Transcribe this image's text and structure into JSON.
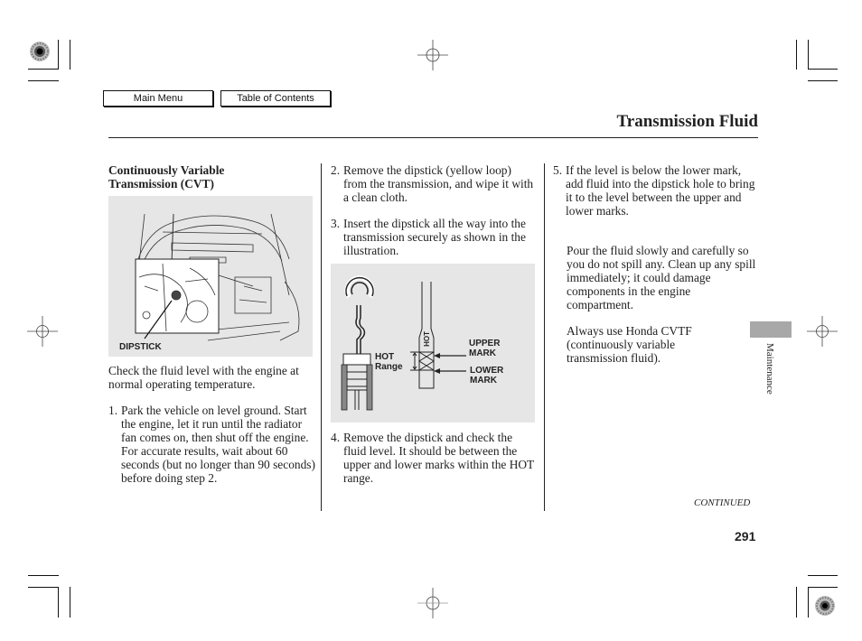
{
  "nav": {
    "main_menu": "Main Menu",
    "table_of_contents": "Table of Contents"
  },
  "page": {
    "title": "Transmission Fluid",
    "section_tab": "Maintenance",
    "continued": "CONTINUED",
    "page_number": "291"
  },
  "column1": {
    "heading_line1": "Continuously Variable",
    "heading_line2": "Transmission (CVT)",
    "figure_label": "DIPSTICK",
    "intro": "Check the fluid level with the engine at normal operating temperature.",
    "step1_num": "1.",
    "step1": "Park the vehicle on level ground. Start the engine, let it run until the radiator fan comes on, then shut off the engine. For accurate results, wait about 60 seconds (but no longer than 90 seconds) before doing step 2."
  },
  "column2": {
    "step2_num": "2.",
    "step2": "Remove the dipstick (yellow loop) from the transmission, and wipe it with a clean cloth.",
    "step3_num": "3.",
    "step3": "Insert the dipstick all the way into the transmission securely as shown in the illustration.",
    "figure": {
      "hot_mark": "HOT",
      "hot_range_line1": "HOT",
      "hot_range_line2": "Range",
      "upper_line1": "UPPER",
      "upper_line2": "MARK",
      "lower_line1": "LOWER",
      "lower_line2": "MARK"
    },
    "step4_num": "4.",
    "step4": "Remove the dipstick and check the fluid level. It should be between the upper and lower marks within the HOT range."
  },
  "column3": {
    "step5_num": "5.",
    "step5": "If the level is below the lower mark, add fluid into the dipstick hole to bring it to the level between the upper and lower marks.",
    "para_pour": "Pour the fluid slowly and carefully so you do not spill any. Clean up any spill immediately; it could damage components in the engine compartment.",
    "para_always": "Always use Honda CVTF (continuously variable transmission fluid)."
  }
}
